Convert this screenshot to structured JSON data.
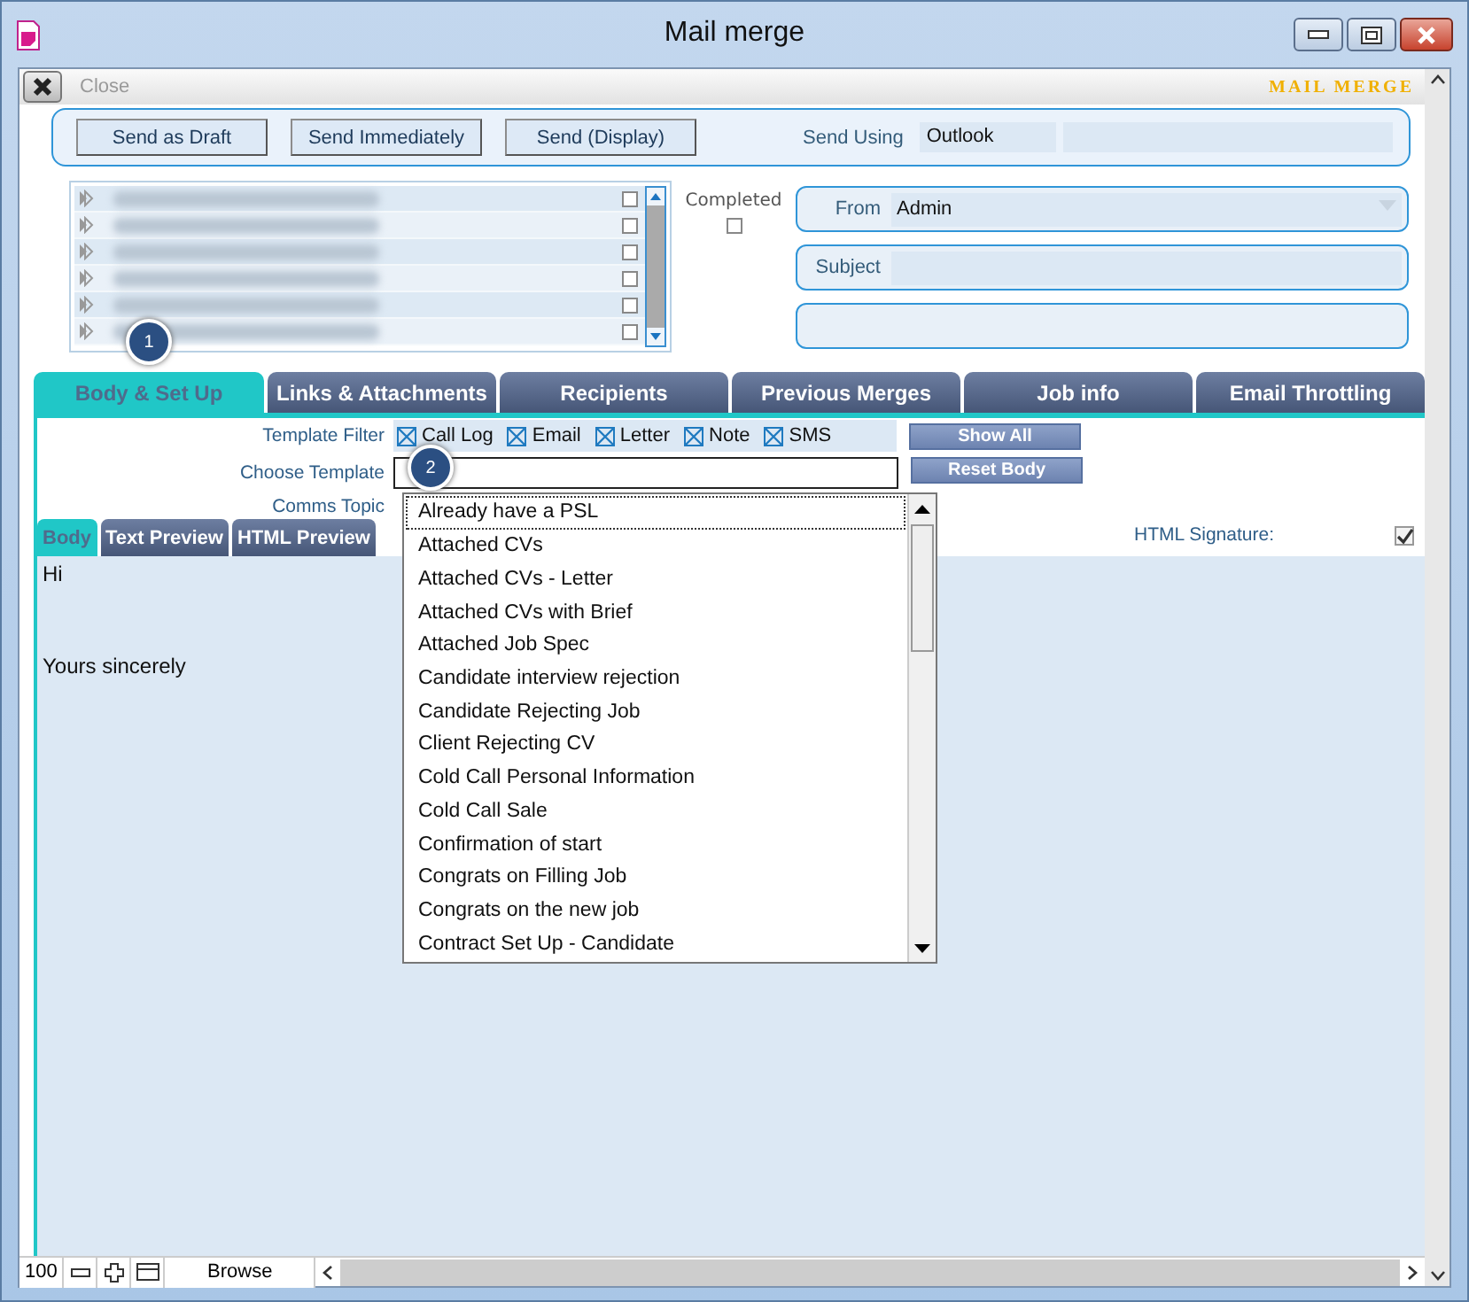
{
  "window": {
    "title": "Mail merge"
  },
  "toolbar": {
    "close_label": "Close",
    "app_title": "MAIL MERGE"
  },
  "send_panel": {
    "buttons": [
      "Send as Draft",
      "Send Immediately",
      "Send (Display)"
    ],
    "send_using": {
      "label": "Send Using",
      "value": "Outlook"
    }
  },
  "recipients": {
    "rows": [
      {
        "checked": false
      },
      {
        "checked": false
      },
      {
        "checked": false
      },
      {
        "checked": false
      },
      {
        "checked": false
      },
      {
        "checked": false
      }
    ]
  },
  "completed": {
    "label": "Completed",
    "checked": false
  },
  "from": {
    "label": "From",
    "value": "Admin"
  },
  "subject": {
    "label": "Subject"
  },
  "tabs": [
    {
      "label": "Body & Set Up",
      "selected": true
    },
    {
      "label": "Links & Attachments",
      "selected": false
    },
    {
      "label": "Recipients",
      "selected": false
    },
    {
      "label": "Previous Merges",
      "selected": false
    },
    {
      "label": "Job info",
      "selected": false
    },
    {
      "label": "Email Throttling",
      "selected": false
    }
  ],
  "callouts": [
    "1",
    "2"
  ],
  "template_filter": {
    "label": "Template Filter",
    "options": [
      {
        "label": "Call Log",
        "checked": true
      },
      {
        "label": "Email",
        "checked": true
      },
      {
        "label": "Letter",
        "checked": true
      },
      {
        "label": "Note",
        "checked": true
      },
      {
        "label": "SMS",
        "checked": true
      }
    ]
  },
  "side_buttons": [
    "Show All",
    "Reset Body"
  ],
  "choose_template": {
    "label": "Choose Template"
  },
  "comms_topic": {
    "label": "Comms Topic"
  },
  "body_tabs": [
    {
      "label": "Body",
      "selected": true
    },
    {
      "label": "Text Preview",
      "selected": false
    },
    {
      "label": "HTML Preview",
      "selected": false
    }
  ],
  "html_signature": {
    "label": "HTML Signature:",
    "checked": true
  },
  "body": {
    "greeting": "Hi",
    "closing": "Yours sincerely"
  },
  "template_dropdown": {
    "items": [
      {
        "label": "Already have a PSL",
        "selected": true
      },
      {
        "label": "Attached CVs",
        "selected": false
      },
      {
        "label": "Attached CVs - Letter",
        "selected": false
      },
      {
        "label": "Attached CVs with Brief",
        "selected": false
      },
      {
        "label": "Attached Job Spec",
        "selected": false
      },
      {
        "label": "Candidate interview rejection",
        "selected": false
      },
      {
        "label": "Candidate Rejecting Job",
        "selected": false
      },
      {
        "label": "Client Rejecting CV",
        "selected": false
      },
      {
        "label": "Cold Call Personal Information",
        "selected": false
      },
      {
        "label": "Cold Call Sale",
        "selected": false
      },
      {
        "label": "Confirmation of start",
        "selected": false
      },
      {
        "label": "Congrats on Filling Job",
        "selected": false
      },
      {
        "label": "Congrats on the new job",
        "selected": false
      },
      {
        "label": "Contract Set Up - Candidate",
        "selected": false
      }
    ]
  },
  "status_bar": {
    "zoom": "100",
    "mode": "Browse"
  }
}
